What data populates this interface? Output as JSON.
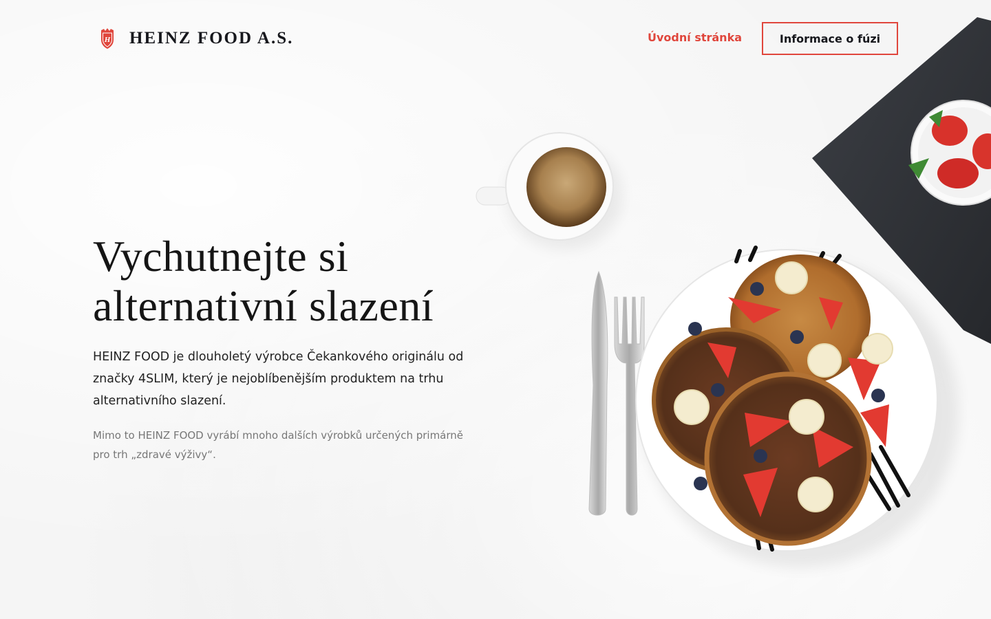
{
  "brand": {
    "name": "HEINZ FOOD A.S.",
    "logo_icon": "shield-monogram-icon",
    "accent_color": "#e0463c"
  },
  "nav": {
    "home_label": "Úvodní stránka",
    "fusion_label": "Informace o fúzi"
  },
  "hero": {
    "title_line1": "Vychutnejte si",
    "title_line2": "alternativní slazení",
    "lead": "HEINZ FOOD je dlouholetý výrobce Čekankového originálu od značky 4SLIM, který je nejoblíbenějším produktem na trhu alternativního slazení.",
    "sub": "Mimo to HEINZ FOOD vyrábí mnoho dalších výrobků určených primárně pro trh „zdravé výživy“."
  },
  "illustration": {
    "icon": "breakfast-pancakes-image"
  }
}
